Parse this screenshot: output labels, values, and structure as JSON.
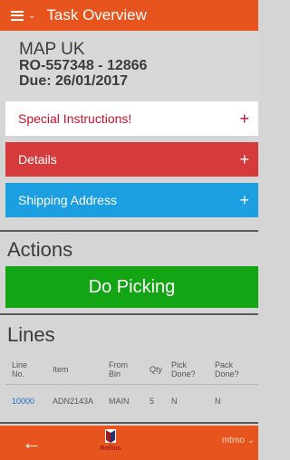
{
  "header": {
    "title": "Task Overview"
  },
  "order": {
    "company": "MAP UK",
    "order_line": "RO-557348 - 12866",
    "due": "Due: 26/01/2017"
  },
  "sections": {
    "special_instructions": "Special Instructions!",
    "details": "Details",
    "shipping_address": "Shipping Address",
    "expand_symbol": "+"
  },
  "actions": {
    "heading": "Actions",
    "do_picking": "Do Picking"
  },
  "lines": {
    "heading": "Lines",
    "columns": {
      "line_no": "Line\nNo.",
      "item": "Item",
      "from_bin": "From\nBin",
      "qty": "Qty",
      "pick_done": "Pick\nDone?",
      "pack_done": "Pack\nDone?"
    },
    "rows": [
      {
        "line_no": "10000",
        "item": "ADN2143A",
        "from_bin": "MAIN",
        "qty": "5",
        "pick_done": "N",
        "pack_done": "N"
      }
    ]
  },
  "footer": {
    "back_symbol": "←",
    "logo_text": "Rollins",
    "user": "mtmo ⌄"
  },
  "colors": {
    "brand": "#e8541e",
    "special": "#c8102e",
    "details": "#d63a3a",
    "shipping": "#1b9fe0",
    "action": "#13a514"
  },
  "icons": [
    "hamburger-menu-icon",
    "chevron-down-icon",
    "plus-icon",
    "back-arrow-icon",
    "rollins-logo"
  ]
}
